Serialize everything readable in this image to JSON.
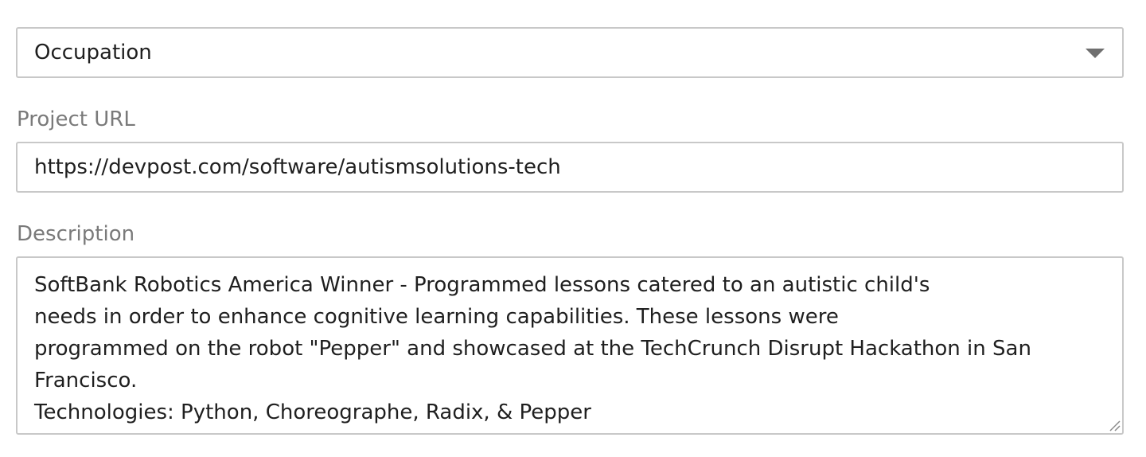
{
  "occupation_select": {
    "selected": "Occupation",
    "icon": "chevron-down-icon"
  },
  "project_url": {
    "label": "Project URL",
    "value": "https://devpost.com/software/autismsolutions-tech"
  },
  "description": {
    "label": "Description",
    "lines": [
      "SoftBank Robotics America Winner - Programmed lessons catered to an autistic child's",
      "needs in order to enhance cognitive learning capabilities. These lessons were",
      "programmed on the robot \"Pepper\" and showcased at the TechCrunch Disrupt Hackathon in San",
      "Francisco.",
      "Technologies: Python, Choreographe, Radix, & Pepper"
    ],
    "resize_icon": "resize-handle-icon"
  },
  "colors": {
    "border": "#c8c8c8",
    "label_text": "#7a7a7a",
    "value_text": "#1f1f1f",
    "arrow": "#6f6f6f"
  }
}
